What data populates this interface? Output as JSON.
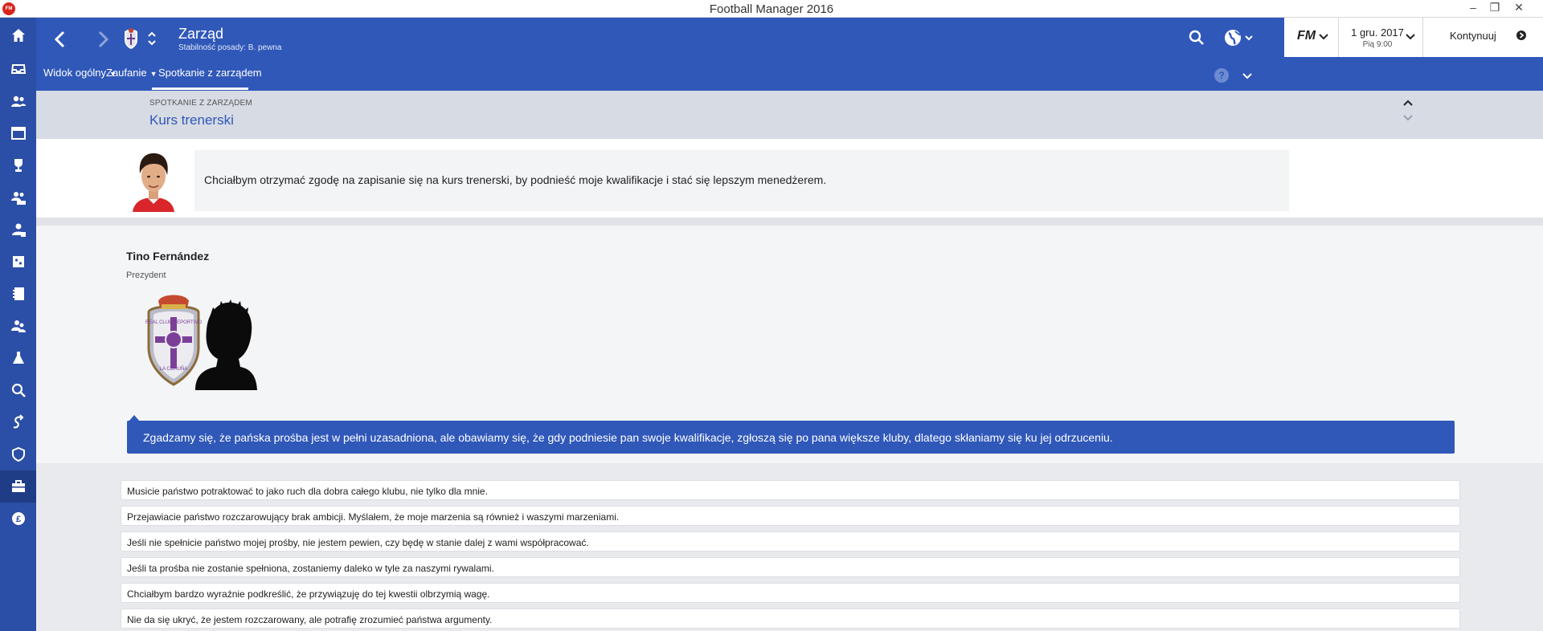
{
  "window": {
    "title": "Football Manager 2016",
    "app_icon_text": "FM",
    "controls": {
      "minimize": "–",
      "maximize": "❐",
      "close": "✕"
    }
  },
  "sidebar": {
    "items": [
      {
        "icon": "home-icon"
      },
      {
        "icon": "inbox-icon"
      },
      {
        "icon": "squad-icon"
      },
      {
        "icon": "schedule-icon"
      },
      {
        "icon": "competitions-icon"
      },
      {
        "icon": "u19-squad-icon"
      },
      {
        "icon": "staff-icon"
      },
      {
        "icon": "tactics-icon"
      },
      {
        "icon": "notebook-icon"
      },
      {
        "icon": "scouting-icon"
      },
      {
        "icon": "training-icon"
      },
      {
        "icon": "search-icon"
      },
      {
        "icon": "transfers-icon"
      },
      {
        "icon": "club-vision-icon"
      },
      {
        "icon": "board-icon",
        "active": true
      },
      {
        "icon": "finances-icon"
      }
    ]
  },
  "header": {
    "title": "Zarząd",
    "subtitle": "Stabilność posady: B. pewna",
    "fm_logo": "FM",
    "date": "1 gru. 2017",
    "time": "Pią 9:00",
    "continue_label": "Kontynuuj",
    "help_label": "?",
    "tabs": [
      {
        "label": "Widok ogólny",
        "has_dropdown": true
      },
      {
        "label": "Zaufanie",
        "has_dropdown": true
      },
      {
        "label": "Spotkanie z zarządem",
        "has_dropdown": false,
        "active": true
      }
    ]
  },
  "section": {
    "kicker": "SPOTKANIE Z ZARZĄDEM",
    "title": "Kurs trenerski"
  },
  "request": {
    "text": "Chciałbym otrzymać zgodę na zapisanie się na kurs trenerski, by podnieść moje kwalifikacje i stać się lepszym menedżerem."
  },
  "president": {
    "name": "Tino Fernández",
    "role": "Prezydent",
    "badge_text_top": "REAL CLUB DEPORTIVO",
    "badge_text_bottom": "LA CORUÑA",
    "response": "Zgadzamy się, że pańska prośba jest w pełni uzasadniona, ale obawiamy się, że gdy podniesie pan swoje kwalifikacje, zgłoszą się po pana większe kluby, dlatego skłaniamy się ku jej odrzuceniu."
  },
  "options": [
    "Musicie państwo potraktować to jako ruch dla dobra całego klubu, nie tylko dla mnie.",
    "Przejawiacie państwo rozczarowujący brak ambicji. Myślałem, że moje marzenia są również i waszymi marzeniami.",
    "Jeśli nie spełnicie państwo mojej prośby, nie jestem pewien, czy będę w stanie dalej z wami współpracować.",
    "Jeśli ta prośba nie zostanie spełniona, zostaniemy daleko w tyle za naszymi rywalami.",
    "Chciałbym bardzo wyraźnie podkreślić, że przywiązuję do tej kwestii olbrzymią wagę.",
    "Nie da się ukryć, że jestem rozczarowany, ale potrafię zrozumieć państwa argumenty."
  ],
  "colors": {
    "header_blue": "#3058b9",
    "sidebar_blue": "#2b4ea6",
    "title_blue": "#2f57b8"
  }
}
